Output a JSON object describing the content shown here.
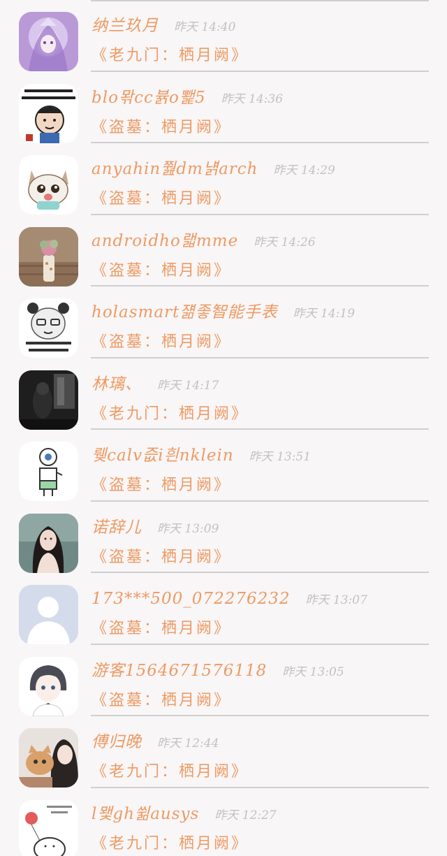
{
  "colors": {
    "name": "#ee9a63",
    "message": "#ee9a63",
    "time": "#c2c2c2",
    "divider": "#cfcfcf",
    "background": "#f8f6f7"
  },
  "comments": [
    {
      "name": "纳兰玖月",
      "time": "昨天 14:40",
      "message": "《老九门：栖月阙》",
      "avatar": "anime-girl-avatar"
    },
    {
      "name": "blo뫆cc뷹o뾅5",
      "time": "昨天 14:36",
      "message": "《盗墓：栖月阙》",
      "avatar": "meme-avatar"
    },
    {
      "name": "anyahin쭲dm냵arch",
      "time": "昨天 14:29",
      "message": "《盗墓：栖月阙》",
      "avatar": "cat-avatar"
    },
    {
      "name": "androidho랣mme",
      "time": "昨天 14:26",
      "message": "《盗墓：栖月阙》",
      "avatar": "plant-avatar"
    },
    {
      "name": "holasmart쟮좋智能手表",
      "time": "昨天 14:19",
      "message": "《盗墓：栖月阙》",
      "avatar": "panda-meme-avatar"
    },
    {
      "name": "林璃、",
      "time": "昨天 14:17",
      "message": "《老九门：栖月阙》",
      "avatar": "dark-photo-avatar"
    },
    {
      "name": "뤶calv즚i흰nklein",
      "time": "昨天 13:51",
      "message": "《盗墓：栖月阙》",
      "avatar": "cartoon-figure-avatar"
    },
    {
      "name": "诺辞儿",
      "time": "昨天 13:09",
      "message": "《盗墓：栖月阙》",
      "avatar": "portrait-avatar"
    },
    {
      "name": "173***500_072276232",
      "time": "昨天 13:07",
      "message": "《盗墓：栖月阙》",
      "avatar": "default-user-avatar"
    },
    {
      "name": "游客1564671576118",
      "time": "昨天 13:05",
      "message": "《盗墓：栖月阙》",
      "avatar": "anime-boy-avatar"
    },
    {
      "name": "傅归晚",
      "time": "昨天 12:44",
      "message": "《老九门：栖月阙》",
      "avatar": "cat-selfie-avatar"
    },
    {
      "name": "l뫷gh쓂ausys",
      "time": "昨天 12:27",
      "message": "《老九门：栖月阙》",
      "avatar": "balloon-doodle-avatar"
    }
  ]
}
